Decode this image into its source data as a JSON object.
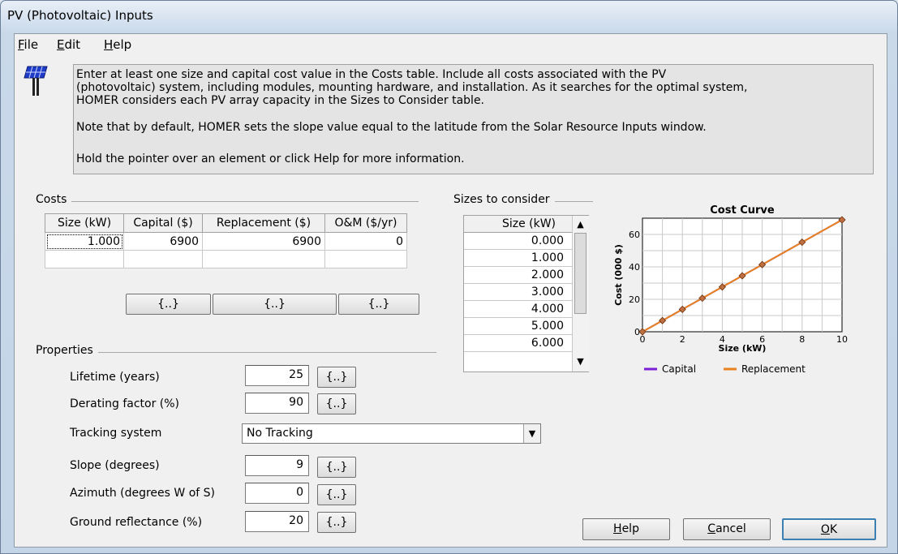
{
  "window": {
    "title": "PV (Photovoltaic) Inputs"
  },
  "menu": [
    {
      "key": "F",
      "rest": "ile"
    },
    {
      "key": "E",
      "rest": "dit"
    },
    {
      "key": "H",
      "rest": "elp"
    }
  ],
  "info": {
    "lines": [
      "Enter at least one size and capital cost value in the Costs table.  Include all costs associated with the PV",
      "(photovoltaic) system, including modules, mounting hardware, and installation. As it searches for the optimal system,",
      "HOMER considers each PV array capacity in the Sizes to Consider table.",
      "Note that by default, HOMER sets the slope value equal to the latitude from the Solar Resource Inputs window.",
      "Hold the pointer over an element or click Help for more information."
    ]
  },
  "costs": {
    "title": "Costs",
    "headers": [
      "Size (kW)",
      "Capital ($)",
      "Replacement ($)",
      "O&M ($/yr)"
    ],
    "rows": [
      [
        "1.000",
        "6900",
        "6900",
        "0"
      ]
    ],
    "button_label": "{..}"
  },
  "sizes": {
    "title": "Sizes to consider",
    "header": "Size (kW)",
    "values": [
      "0.000",
      "1.000",
      "2.000",
      "3.000",
      "4.000",
      "5.000",
      "6.000"
    ]
  },
  "properties": {
    "title": "Properties",
    "button_label": "{..}",
    "lifetime": {
      "label": "Lifetime (years)",
      "value": "25"
    },
    "derating": {
      "label": "Derating factor (%)",
      "value": "90"
    },
    "tracking": {
      "label": "Tracking system",
      "value": "No Tracking"
    },
    "slope": {
      "label": "Slope (degrees)",
      "value": "9"
    },
    "azimuth": {
      "label": "Azimuth (degrees W of S)",
      "value": "0"
    },
    "reflectance": {
      "label": "Ground reflectance (%)",
      "value": "20"
    }
  },
  "buttons": {
    "help": {
      "key": "H",
      "rest": "elp"
    },
    "cancel": {
      "key": "C",
      "rest": "ancel"
    },
    "ok": {
      "key": "O",
      "rest": "K"
    }
  },
  "chart_data": {
    "type": "line",
    "title": "Cost Curve",
    "xlabel": "Size (kW)",
    "ylabel": "Cost (000 $)",
    "xlim": [
      0,
      10
    ],
    "ylim": [
      0,
      70
    ],
    "xticks": [
      0,
      2,
      4,
      6,
      8,
      10
    ],
    "yticks": [
      0,
      20,
      40,
      60
    ],
    "grid": true,
    "legend_position": "bottom",
    "x": [
      0,
      1,
      2,
      3,
      4,
      5,
      6,
      8,
      10
    ],
    "series": [
      {
        "name": "Capital",
        "color": "#7b1fd6",
        "values": [
          0,
          6.9,
          13.8,
          20.7,
          27.6,
          34.5,
          41.4,
          55.2,
          69
        ]
      },
      {
        "name": "Replacement",
        "color": "#e8821e",
        "values": [
          0,
          6.9,
          13.8,
          20.7,
          27.6,
          34.5,
          41.4,
          55.2,
          69
        ]
      }
    ]
  }
}
